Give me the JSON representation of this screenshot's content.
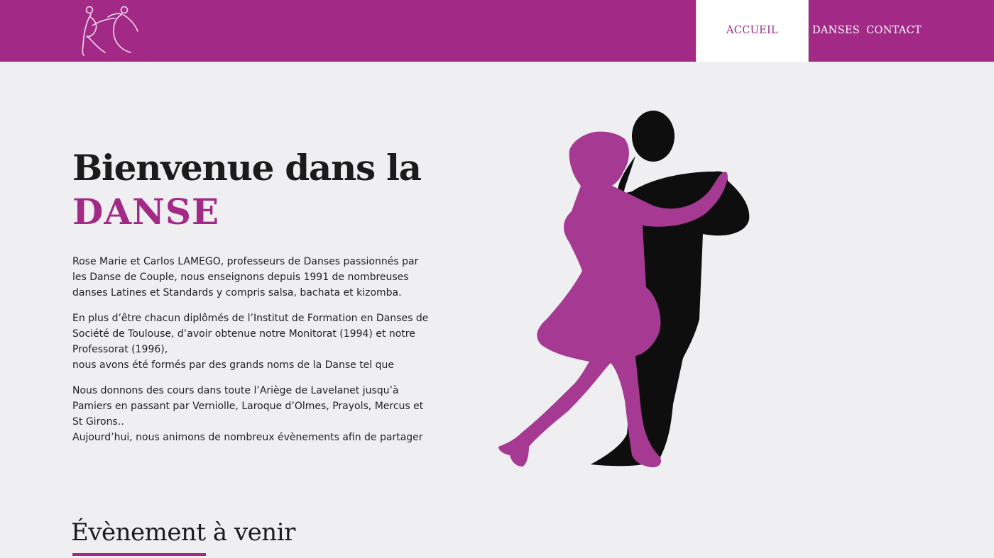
{
  "nav": {
    "items": [
      {
        "label": "ACCUEIL",
        "active": true
      },
      {
        "label": "DANSES",
        "active": false
      },
      {
        "label": "CONTACT",
        "active": false
      }
    ]
  },
  "hero": {
    "title_line1": "Bienvenue dans la",
    "title_line2": "DANSE"
  },
  "intro": {
    "paragraphs": [
      [
        "Rose Marie et Carlos LAMEGO, professeurs de Danses passionnés par",
        "les Danse de Couple, nous enseignons depuis 1991 de nombreuses",
        "danses Latines et Standards y compris salsa, bachata et kizomba."
      ],
      [
        "En plus d’être chacun diplômés de l’Institut de Formation en Danses de",
        "Société de Toulouse, d’avoir obtenue notre Monitorat (1994) et notre",
        "Professorat (1996),",
        "nous avons été formés par des grands noms de la Danse tel que"
      ],
      [
        "Nous donnons des cours dans toute l’Ariège de Lavelanet jusqu’à",
        "Pamiers en passant par Verniolle, Laroque d’Olmes, Prayols, Mercus et",
        "St Girons..",
        "Aujourd’hui, nous animons de nombreux évènements afin de partager"
      ]
    ]
  },
  "events": {
    "title": "Évènement à venir"
  },
  "colors": {
    "brand": "#a22a86",
    "background": "#efeef0",
    "silhouette_woman": "#a63a93",
    "silhouette_man": "#0e0e0e"
  },
  "icons": {
    "logo": "dancing-couple-logo-icon",
    "illustration": "dancing-couple-silhouette"
  }
}
